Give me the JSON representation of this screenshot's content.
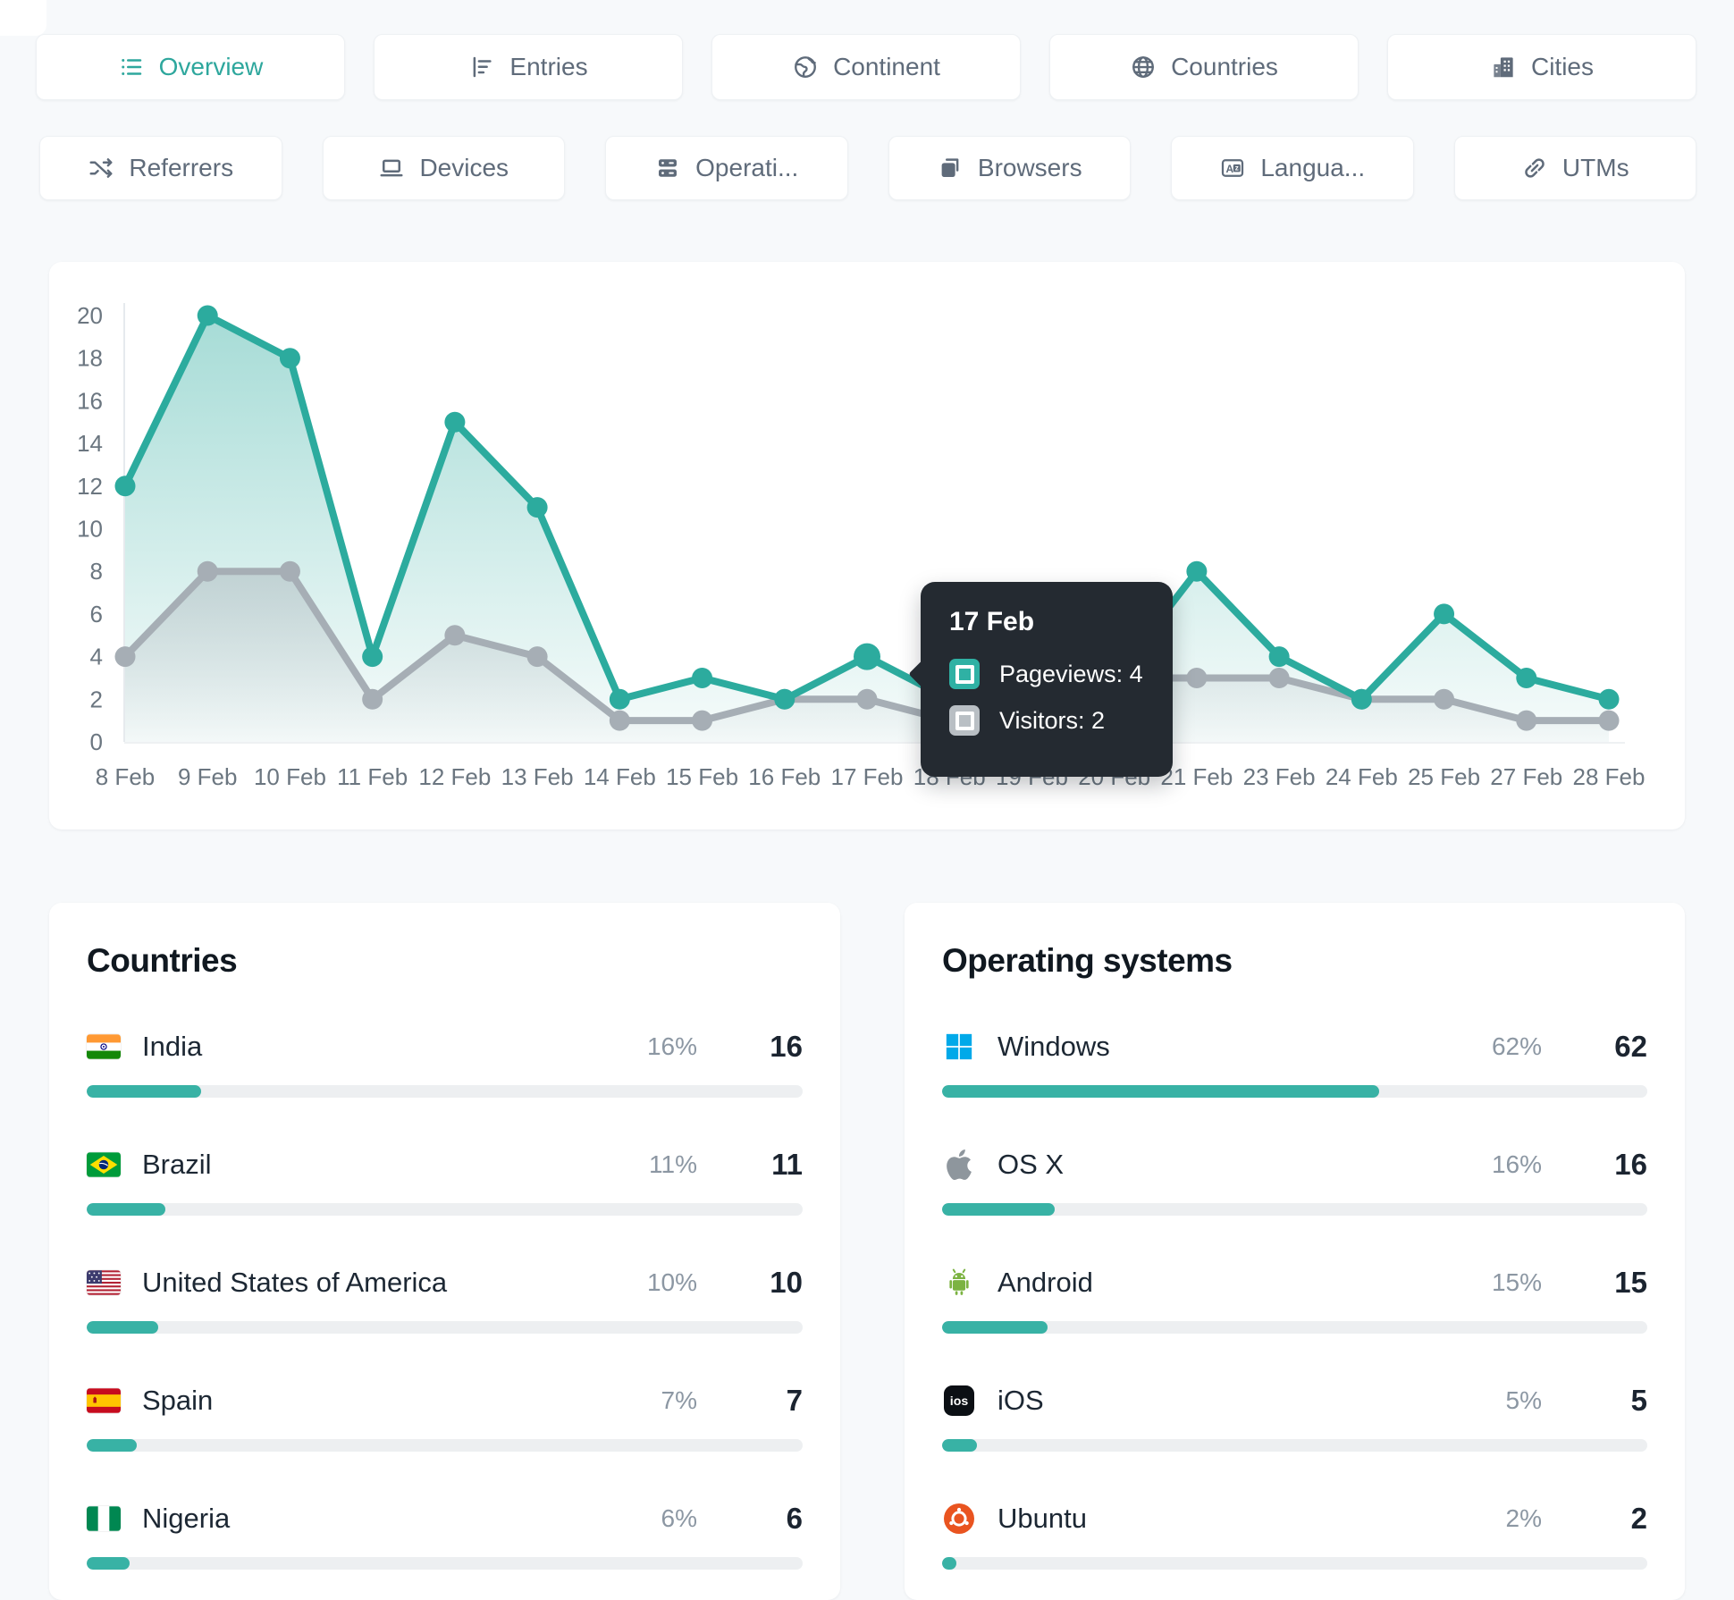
{
  "page": {
    "background": "#f7f9fb",
    "accent": "#2ea79d"
  },
  "tabs": {
    "row1": [
      {
        "label": "Overview",
        "icon": "list-icon",
        "active": true
      },
      {
        "label": "Entries",
        "icon": "bar-chart-icon",
        "active": false
      },
      {
        "label": "Continent",
        "icon": "earth-icon",
        "active": false
      },
      {
        "label": "Countries",
        "icon": "globe-icon",
        "active": false
      },
      {
        "label": "Cities",
        "icon": "buildings-icon",
        "active": false
      }
    ],
    "row2": [
      {
        "label": "Referrers",
        "icon": "shuffle-icon"
      },
      {
        "label": "Devices",
        "icon": "laptop-icon"
      },
      {
        "label": "Operati...",
        "icon": "server-icon"
      },
      {
        "label": "Browsers",
        "icon": "window-stack-icon"
      },
      {
        "label": "Langua...",
        "icon": "translate-icon"
      },
      {
        "label": "UTMs",
        "icon": "link-icon"
      }
    ]
  },
  "chart_data": {
    "type": "area",
    "categories": [
      "8 Feb",
      "9 Feb",
      "10 Feb",
      "11 Feb",
      "12 Feb",
      "13 Feb",
      "14 Feb",
      "15 Feb",
      "16 Feb",
      "17 Feb",
      "18 Feb",
      "19 Feb",
      "20 Feb",
      "21 Feb",
      "23 Feb",
      "24 Feb",
      "25 Feb",
      "27 Feb",
      "28 Feb"
    ],
    "series": [
      {
        "name": "Pageviews",
        "color": "#2cab9e",
        "values": [
          12,
          20,
          18,
          4,
          15,
          11,
          2,
          3,
          2,
          4,
          2,
          1,
          3,
          8,
          4,
          2,
          6,
          3,
          2
        ]
      },
      {
        "name": "Visitors",
        "color": "#a6aeb5",
        "values": [
          4,
          8,
          8,
          2,
          5,
          4,
          1,
          1,
          2,
          2,
          1,
          1,
          3,
          3,
          3,
          2,
          2,
          1,
          1
        ]
      }
    ],
    "ylim": [
      0,
      20
    ],
    "ytick_step": 2,
    "grid": false,
    "legend_position": "none",
    "highlight_index": 9
  },
  "tooltip": {
    "bg": "#242a31",
    "title": "17 Feb",
    "rows": [
      {
        "text": "Pageviews: 4",
        "color": "#2fb1a4"
      },
      {
        "text": "Visitors: 2",
        "color": "#b9bfc4"
      }
    ]
  },
  "panels": {
    "bar_color": "#38b2a5",
    "countries": {
      "title": "Countries",
      "rows": [
        {
          "name": "India",
          "flag": "india-flag",
          "pct": 16,
          "pct_label": "16%",
          "count": "16"
        },
        {
          "name": "Brazil",
          "flag": "brazil-flag",
          "pct": 11,
          "pct_label": "11%",
          "count": "11"
        },
        {
          "name": "United States of America",
          "flag": "usa-flag",
          "pct": 10,
          "pct_label": "10%",
          "count": "10"
        },
        {
          "name": "Spain",
          "flag": "spain-flag",
          "pct": 7,
          "pct_label": "7%",
          "count": "7"
        },
        {
          "name": "Nigeria",
          "flag": "nigeria-flag",
          "pct": 6,
          "pct_label": "6%",
          "count": "6"
        }
      ]
    },
    "operating_systems": {
      "title": "Operating systems",
      "rows": [
        {
          "name": "Windows",
          "icon": "windows-logo-icon",
          "pct": 62,
          "pct_label": "62%",
          "count": "62"
        },
        {
          "name": "OS X",
          "icon": "apple-logo-icon",
          "pct": 16,
          "pct_label": "16%",
          "count": "16"
        },
        {
          "name": "Android",
          "icon": "android-logo-icon",
          "pct": 15,
          "pct_label": "15%",
          "count": "15"
        },
        {
          "name": "iOS",
          "icon": "ios-logo-icon",
          "pct": 5,
          "pct_label": "5%",
          "count": "5"
        },
        {
          "name": "Ubuntu",
          "icon": "ubuntu-logo-icon",
          "pct": 2,
          "pct_label": "2%",
          "count": "2"
        }
      ]
    }
  }
}
